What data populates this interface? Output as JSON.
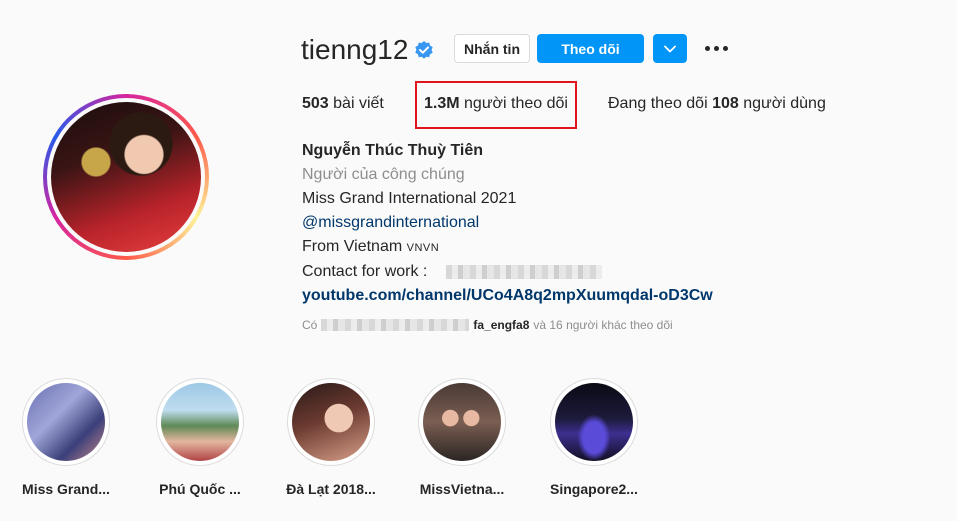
{
  "profile": {
    "username": "tienng12",
    "verified": true,
    "buttons": {
      "message": "Nhắn tin",
      "follow": "Theo dõi"
    },
    "stats": {
      "posts_count": "503",
      "posts_label": "bài viết",
      "followers_count": "1.3M",
      "followers_label": "người theo dõi",
      "following_prefix": "Đang theo dõi",
      "following_count": "108",
      "following_label": "người dùng"
    },
    "bio": {
      "full_name": "Nguyễn Thúc Thuỳ Tiên",
      "category": "Người của công chúng",
      "line1": "Miss Grand International 2021",
      "mention": "@missgrandinternational",
      "from": "From Vietnam",
      "flag": "VNVN",
      "contact": "Contact for work :",
      "link": "youtube.com/channel/UCo4A8q2mpXuumqdal-oD3Cw"
    },
    "followed_by": {
      "prefix": "Có",
      "username": "fa_engfa8",
      "suffix": "và 16 người khác theo dõi"
    }
  },
  "highlights": [
    {
      "label": "Miss Grand..."
    },
    {
      "label": "Phú Quốc ..."
    },
    {
      "label": "Đà Lạt 2018..."
    },
    {
      "label": "MissVietna..."
    },
    {
      "label": "Singapore2..."
    }
  ],
  "colors": {
    "primary": "#0095f6",
    "highlight_box": "#e0141a",
    "link": "#00376b",
    "secondary_text": "#8e8e8e"
  }
}
